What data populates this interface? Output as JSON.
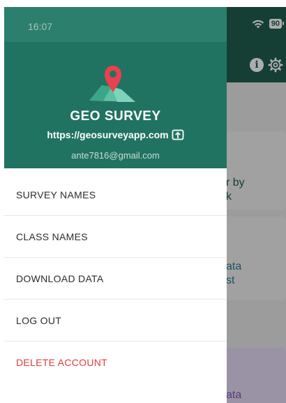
{
  "status_bar": {
    "time": "16:07",
    "battery": "90"
  },
  "drawer": {
    "app_name": "GEO SURVEY",
    "url": "https://geosurveyapp.com",
    "email": "ante7816@gmail.com",
    "menu": [
      {
        "label": "SURVEY NAMES"
      },
      {
        "label": "CLASS NAMES"
      },
      {
        "label": "DOWNLOAD DATA"
      },
      {
        "label": "LOG OUT"
      },
      {
        "label": "DELETE ACCOUNT"
      }
    ]
  },
  "background_cards": [
    {
      "text_line1": "r by",
      "text_line2": "k"
    },
    {
      "text_line1": "ata",
      "text_line2": "st"
    },
    {
      "text_line1": "ata"
    }
  ],
  "colors": {
    "drawer_header": "#217361",
    "app_bar": "#1f5e4f",
    "danger": "#e13b3b"
  },
  "icons": [
    "wifi-icon",
    "battery-icon",
    "info-icon",
    "gear-icon",
    "map-pin-logo-icon",
    "open-link-icon"
  ]
}
